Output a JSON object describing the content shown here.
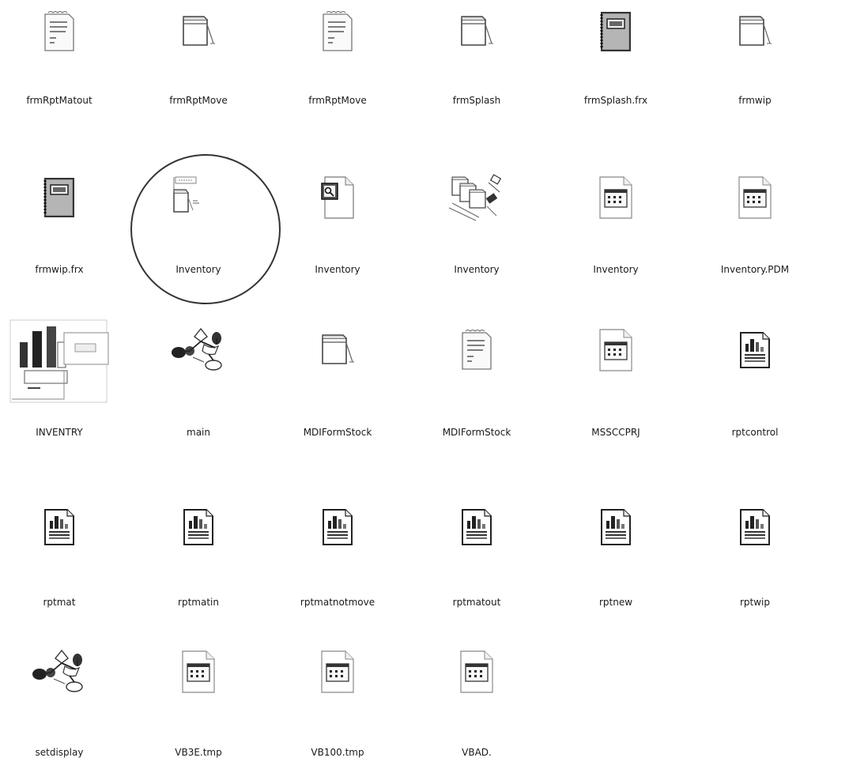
{
  "files": [
    {
      "label": "frmRptMatout",
      "icon": "text-document-icon",
      "name": "file-frmrptmatout"
    },
    {
      "label": "frmRptMove",
      "icon": "form-window-icon",
      "name": "file-frmrptmove-form"
    },
    {
      "label": "frmRptMove",
      "icon": "text-document-icon",
      "name": "file-frmrptmove-text"
    },
    {
      "label": "frmSplash",
      "icon": "form-window-icon",
      "name": "file-frmsplash"
    },
    {
      "label": "frmSplash.frx",
      "icon": "binary-notebook-icon",
      "name": "file-frmsplash-frx"
    },
    {
      "label": "frmwip",
      "icon": "form-window-icon",
      "name": "file-frmwip"
    },
    {
      "label": "frmwip.frx",
      "icon": "binary-notebook-icon",
      "name": "file-frmwip-frx"
    },
    {
      "label": "Inventory",
      "icon": "vb-project-icon",
      "name": "file-inventory-project"
    },
    {
      "label": "Inventory",
      "icon": "key-document-icon",
      "name": "file-inventory-key"
    },
    {
      "label": "Inventory",
      "icon": "project-group-icon",
      "name": "file-inventory-group"
    },
    {
      "label": "Inventory",
      "icon": "calendar-document-icon",
      "name": "file-inventory-calendar"
    },
    {
      "label": "Inventory.PDM",
      "icon": "calendar-document-icon",
      "name": "file-inventory-pdm"
    },
    {
      "label": "INVENTRY",
      "icon": "database-report-icon",
      "name": "file-inventry"
    },
    {
      "label": "main",
      "icon": "module-network-icon",
      "name": "file-main"
    },
    {
      "label": "MDIFormStock",
      "icon": "form-window-icon",
      "name": "file-mdiformstock-form"
    },
    {
      "label": "MDIFormStock",
      "icon": "text-document-icon",
      "name": "file-mdiformstock-text"
    },
    {
      "label": "MSSCCPRJ",
      "icon": "calendar-document-icon",
      "name": "file-mssccprj"
    },
    {
      "label": "rptcontrol",
      "icon": "report-chart-icon",
      "name": "file-rptcontrol"
    },
    {
      "label": "rptmat",
      "icon": "report-chart-icon",
      "name": "file-rptmat"
    },
    {
      "label": "rptmatin",
      "icon": "report-chart-icon",
      "name": "file-rptmatin"
    },
    {
      "label": "rptmatnotmove",
      "icon": "report-chart-icon",
      "name": "file-rptmatnotmove"
    },
    {
      "label": "rptmatout",
      "icon": "report-chart-icon",
      "name": "file-rptmatout"
    },
    {
      "label": "rptnew",
      "icon": "report-chart-icon",
      "name": "file-rptnew"
    },
    {
      "label": "rptwip",
      "icon": "report-chart-icon",
      "name": "file-rptwip"
    },
    {
      "label": "setdisplay",
      "icon": "module-network-icon",
      "name": "file-setdisplay"
    },
    {
      "label": "VB3E.tmp",
      "icon": "calendar-document-icon",
      "name": "file-vb3e-tmp"
    },
    {
      "label": "VB100.tmp",
      "icon": "calendar-document-icon",
      "name": "file-vb100-tmp"
    },
    {
      "label": "VBAD.",
      "icon": "calendar-document-icon",
      "name": "file-vbad"
    }
  ]
}
